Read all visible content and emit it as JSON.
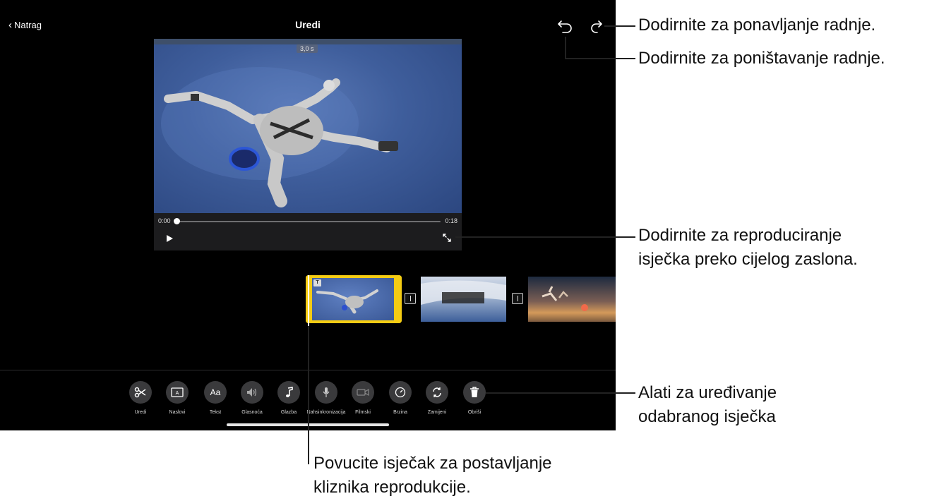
{
  "nav": {
    "back_label": "Natrag",
    "title": "Uredi"
  },
  "viewer": {
    "duration_badge": "3,0 s",
    "time_start": "0:00",
    "time_end": "0:18",
    "playback_position": 0.0
  },
  "toolbar": {
    "items": [
      {
        "label": "Uredi",
        "icon": "scissors-icon"
      },
      {
        "label": "Naslovi",
        "icon": "titles-icon"
      },
      {
        "label": "Tekst",
        "icon": "text-icon",
        "glyph": "Aa"
      },
      {
        "label": "Glasnoća",
        "icon": "speaker-icon"
      },
      {
        "label": "Glazba",
        "icon": "music-note-icon"
      },
      {
        "label": "Nahsinkronizacija",
        "icon": "microphone-icon"
      },
      {
        "label": "Filmski",
        "icon": "cinematic-icon"
      },
      {
        "label": "Brzina",
        "icon": "speedometer-icon"
      },
      {
        "label": "Zamijeni",
        "icon": "replace-icon"
      },
      {
        "label": "Obriši",
        "icon": "trash-icon"
      }
    ]
  },
  "timeline": {
    "selected_clip_badge": "T"
  },
  "callouts": {
    "redo": "Dodirnite za ponavljanje radnje.",
    "undo": "Dodirnite za poništavanje radnje.",
    "fullscreen_line1": "Dodirnite za reproduciranje",
    "fullscreen_line2": "isječka preko cijelog zaslona.",
    "tools_line1": "Alati za uređivanje",
    "tools_line2": "odabranog isječka",
    "drag_line1": "Povucite isječak za postavljanje",
    "drag_line2": "kliznika reprodukcije."
  },
  "colors": {
    "selection_yellow": "#f5cc13",
    "screen_bg": "#000000"
  }
}
